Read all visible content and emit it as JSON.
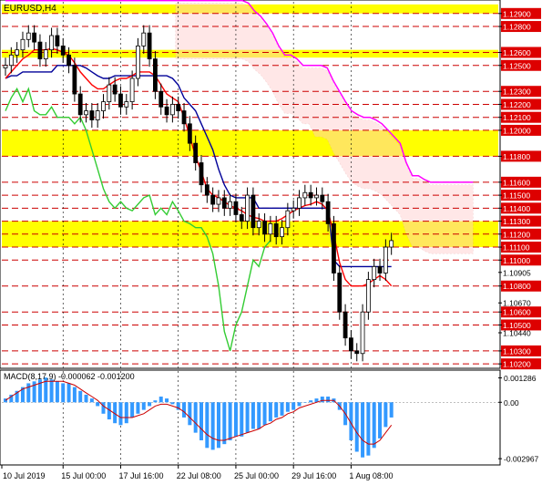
{
  "chart_data": [
    {
      "type": "candlestick",
      "title": "EURUSD,H4",
      "price_labels": [
        "1.12900",
        "1.12800",
        "1.12600",
        "1.12500",
        "1.12300",
        "1.12200",
        "1.12100",
        "1.12000",
        "1.11800",
        "1.11600",
        "1.11500",
        "1.11400",
        "1.11300",
        "1.11200",
        "1.11100",
        "1.11000",
        "1.10905",
        "1.10800",
        "1.10670",
        "1.10600",
        "1.10500",
        "1.10440",
        "1.10300",
        "1.10200"
      ],
      "highlighted_labels": [
        "1.12900",
        "1.12800",
        "1.12600",
        "1.12500",
        "1.12300",
        "1.12200",
        "1.12100",
        "1.12000",
        "1.11800",
        "1.11600",
        "1.11500",
        "1.11400",
        "1.11300",
        "1.11200",
        "1.11100",
        "1.11000",
        "1.10800",
        "1.10600",
        "1.10500",
        "1.10300",
        "1.10200"
      ],
      "resistance_bands": [
        [
          1.129,
          1.1297
        ],
        [
          1.1256,
          1.1262
        ],
        [
          1.118,
          1.12
        ],
        [
          1.111,
          1.113
        ]
      ],
      "horizontal_levels": [
        1.129,
        1.128,
        1.126,
        1.125,
        1.123,
        1.122,
        1.121,
        1.12,
        1.118,
        1.116,
        1.115,
        1.114,
        1.113,
        1.112,
        1.111,
        1.11,
        1.108,
        1.106,
        1.105,
        1.103,
        1.102
      ],
      "ylim": [
        1.1018,
        1.1299
      ],
      "x_labels": [
        "10 Jul 2019",
        "15 Jul 00:00",
        "17 Jul 16:00",
        "22 Jul 08:00",
        "25 Jul 00:00",
        "29 Jul 16:00",
        "1 Aug 08:00"
      ],
      "close": [
        1.125,
        1.1258,
        1.1262,
        1.127,
        1.1275,
        1.1268,
        1.1255,
        1.1262,
        1.1273,
        1.1265,
        1.1258,
        1.125,
        1.1228,
        1.1212,
        1.1215,
        1.1208,
        1.1215,
        1.1222,
        1.1235,
        1.1228,
        1.1218,
        1.1222,
        1.124,
        1.1265,
        1.1275,
        1.1255,
        1.123,
        1.1218,
        1.1212,
        1.122,
        1.1215,
        1.1205,
        1.119,
        1.1175,
        1.1158,
        1.115,
        1.1143,
        1.1148,
        1.114,
        1.1145,
        1.1135,
        1.113,
        1.115,
        1.1125,
        1.113,
        1.112,
        1.1128,
        1.1118,
        1.1125,
        1.1138,
        1.114,
        1.1148,
        1.1152,
        1.1148,
        1.115,
        1.1145,
        1.1128,
        1.109,
        1.106,
        1.104,
        1.103,
        1.1028,
        1.106,
        1.1085,
        1.1095,
        1.109,
        1.111,
        1.1115
      ],
      "open": [
        1.1248,
        1.125,
        1.1258,
        1.1262,
        1.127,
        1.1275,
        1.1268,
        1.1255,
        1.1262,
        1.1273,
        1.1265,
        1.1258,
        1.125,
        1.1228,
        1.1212,
        1.1215,
        1.1208,
        1.1215,
        1.1222,
        1.1235,
        1.1228,
        1.1218,
        1.1222,
        1.124,
        1.1265,
        1.1275,
        1.1255,
        1.123,
        1.1218,
        1.1212,
        1.122,
        1.1215,
        1.1205,
        1.119,
        1.1175,
        1.1158,
        1.115,
        1.1143,
        1.1148,
        1.114,
        1.1145,
        1.1135,
        1.113,
        1.115,
        1.1125,
        1.113,
        1.112,
        1.1128,
        1.1118,
        1.1125,
        1.1138,
        1.114,
        1.1148,
        1.1152,
        1.1148,
        1.115,
        1.1145,
        1.1128,
        1.109,
        1.106,
        1.104,
        1.103,
        1.1028,
        1.106,
        1.1085,
        1.1095,
        1.109,
        1.111
      ],
      "tenkan_sen": [
        1.124,
        1.1245,
        1.125,
        1.1255,
        1.1258,
        1.1262,
        1.1262,
        1.1262,
        1.1263,
        1.1262,
        1.126,
        1.1258,
        1.1252,
        1.1245,
        1.124,
        1.1235,
        1.1232,
        1.1232,
        1.1235,
        1.1238,
        1.124,
        1.124,
        1.1242,
        1.1245,
        1.1245,
        1.1245,
        1.1242,
        1.1235,
        1.1228,
        1.1225,
        1.1222,
        1.121,
        1.1195,
        1.118,
        1.1168,
        1.1155,
        1.115,
        1.1148,
        1.1145,
        1.1142,
        1.114,
        1.1138,
        1.1135,
        1.1133,
        1.1132,
        1.113,
        1.113,
        1.113,
        1.1132,
        1.1135,
        1.1138,
        1.114,
        1.1142,
        1.1143,
        1.1145,
        1.1143,
        1.1138,
        1.112,
        1.1098,
        1.1085,
        1.108,
        1.108,
        1.108,
        1.1082,
        1.1085,
        1.1088,
        1.1085,
        1.108
      ],
      "kijun_sen": [
        1.124,
        1.1242,
        1.1242,
        1.1245,
        1.1245,
        1.1245,
        1.1245,
        1.1245,
        1.1245,
        1.125,
        1.125,
        1.125,
        1.125,
        1.125,
        1.1248,
        1.1245,
        1.1242,
        1.124,
        1.124,
        1.1242,
        1.1242,
        1.1242,
        1.1242,
        1.1242,
        1.1242,
        1.1242,
        1.1242,
        1.1242,
        1.1242,
        1.124,
        1.1235,
        1.1225,
        1.122,
        1.1215,
        1.1205,
        1.1195,
        1.1185,
        1.117,
        1.1158,
        1.115,
        1.1148,
        1.1148,
        1.1148,
        1.1148,
        1.114,
        1.114,
        1.114,
        1.114,
        1.114,
        1.114,
        1.114,
        1.114,
        1.114,
        1.114,
        1.114,
        1.114,
        1.114,
        1.11,
        1.1095,
        1.1095,
        1.1095,
        1.1095,
        1.1095,
        1.1095,
        1.1095,
        1.1095,
        1.1095,
        1.1095
      ],
      "chikou_span": [
        1.1215,
        1.1225,
        1.1232,
        1.1222,
        1.1232,
        1.1215,
        1.1212,
        1.1212,
        1.1218,
        1.121,
        1.121,
        1.121,
        1.1205,
        1.121,
        1.12,
        1.1185,
        1.117,
        1.1155,
        1.1145,
        1.114,
        1.1145,
        1.114,
        1.1138,
        1.1143,
        1.1148,
        1.115,
        1.1135,
        1.114,
        1.1135,
        1.1145,
        1.1138,
        1.113,
        1.1128,
        1.1125,
        1.1125,
        1.1118,
        1.1105,
        1.108,
        1.1045,
        1.103,
        1.105,
        1.106,
        1.108,
        1.11,
        1.1095,
        1.111,
        1.1115
      ],
      "senkou_span_b": [
        1.13,
        1.13,
        1.13,
        1.13,
        1.13,
        1.13,
        1.13,
        1.13,
        1.13,
        1.13,
        1.13,
        1.13,
        1.13,
        1.13,
        1.13,
        1.13,
        1.13,
        1.13,
        1.13,
        1.13,
        1.13,
        1.13,
        1.13,
        1.13,
        1.13,
        1.13,
        1.13,
        1.13,
        1.13,
        1.13,
        1.13,
        1.13,
        1.13,
        1.13,
        1.13,
        1.13,
        1.13,
        1.13,
        1.13,
        1.13,
        1.1298,
        1.1292,
        1.1288,
        1.1282,
        1.1275,
        1.1265,
        1.1258,
        1.1258,
        1.1255,
        1.125,
        1.125,
        1.125,
        1.125,
        1.1248,
        1.1238,
        1.123,
        1.1222,
        1.1215,
        1.1212,
        1.121,
        1.121,
        1.1208,
        1.1205,
        1.12,
        1.1195,
        1.119,
        1.1175,
        1.1165,
        1.1165,
        1.1162,
        1.116,
        1.116,
        1.116,
        1.116,
        1.116,
        1.116,
        1.116,
        1.116
      ]
    },
    {
      "type": "histogram",
      "title": "MACD(8,17,9) -0.000062 -0.001200",
      "y_labels": [
        "0.001286",
        "0.00",
        "-0.002967"
      ],
      "ylim": [
        -0.0032,
        0.0015
      ],
      "histogram": [
        0.0002,
        0.0004,
        0.0006,
        0.0008,
        0.001,
        0.0011,
        0.0012,
        0.0013,
        0.0012,
        0.0011,
        0.001,
        0.001,
        0.0008,
        0.0006,
        0.0004,
        0.0002,
        -0.0002,
        -0.0006,
        -0.0009,
        -0.0011,
        -0.0012,
        -0.0011,
        -0.0008,
        -0.0006,
        -0.0004,
        -0.0002,
        0.0001,
        0.0003,
        0.0002,
        -0.0001,
        -0.0004,
        -0.0008,
        -0.0012,
        -0.0016,
        -0.002,
        -0.0024,
        -0.0025,
        -0.0024,
        -0.0022,
        -0.002,
        -0.0018,
        -0.0018,
        -0.0016,
        -0.0014,
        -0.0014,
        -0.0012,
        -0.001,
        -0.0008,
        -0.0007,
        -0.0005,
        -0.0004,
        -0.0002,
        0.0,
        0.0001,
        0.0002,
        0.0003,
        0.0003,
        0.0002,
        -0.0004,
        -0.0012,
        -0.002,
        -0.0026,
        -0.0029,
        -0.0028,
        -0.0024,
        -0.0019,
        -0.0013,
        -0.0008
      ],
      "signal": [
        0.0001,
        0.0003,
        0.0005,
        0.0007,
        0.0008,
        0.0009,
        0.001,
        0.0011,
        0.0011,
        0.0011,
        0.0011,
        0.001,
        0.0009,
        0.0007,
        0.0005,
        0.0003,
        0.0001,
        -0.0002,
        -0.0004,
        -0.0006,
        -0.0008,
        -0.0008,
        -0.0008,
        -0.0007,
        -0.0006,
        -0.0004,
        -0.0002,
        -0.0001,
        -0.0001,
        -0.0002,
        -0.0003,
        -0.0005,
        -0.0008,
        -0.0011,
        -0.0014,
        -0.0017,
        -0.0019,
        -0.002,
        -0.002,
        -0.0019,
        -0.0018,
        -0.0017,
        -0.0016,
        -0.0015,
        -0.0014,
        -0.0012,
        -0.0011,
        -0.0009,
        -0.0008,
        -0.0006,
        -0.0005,
        -0.0003,
        -0.0002,
        -0.0001,
        0.0,
        0.0001,
        0.0001,
        0.0001,
        -0.0002,
        -0.0006,
        -0.0011,
        -0.0016,
        -0.002,
        -0.0022,
        -0.0022,
        -0.002,
        -0.0016,
        -0.0012
      ]
    }
  ],
  "colors": {
    "band": "#ffff00",
    "level": "#cc0000",
    "label_bg": "#dd0000",
    "candle": "#000000",
    "tenkan": "#ff0000",
    "kijun": "#000099",
    "chikou": "#33cc33",
    "senkou_b": "#ff00ff",
    "cloud": "#ffcccc",
    "macd_hist": "#3399ff",
    "macd_signal": "#cc0000"
  }
}
